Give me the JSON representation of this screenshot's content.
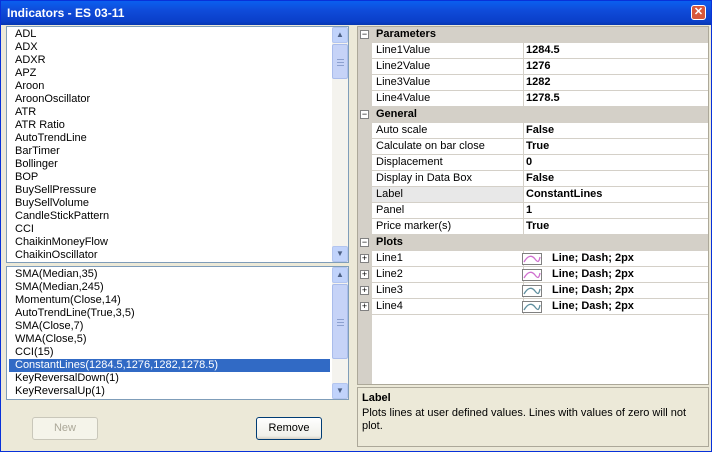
{
  "window": {
    "title": "Indicators - ES 03-11",
    "close_icon": "close-icon"
  },
  "indicator_list": {
    "items": [
      "ADL",
      "ADX",
      "ADXR",
      "APZ",
      "Aroon",
      "AroonOscillator",
      "ATR",
      "ATR Ratio",
      "AutoTrendLine",
      "BarTimer",
      "Bollinger",
      "BOP",
      "BuySellPressure",
      "BuySellVolume",
      "CandleStickPattern",
      "CCI",
      "ChaikinMoneyFlow",
      "ChaikinOscillator"
    ]
  },
  "applied_list": {
    "items": [
      "SMA(Median,35)",
      "SMA(Median,245)",
      "Momentum(Close,14)",
      "AutoTrendLine(True,3,5)",
      "SMA(Close,7)",
      "WMA(Close,5)",
      "CCI(15)",
      "ConstantLines(1284.5,1276,1282,1278.5)",
      "KeyReversalDown(1)",
      "KeyReversalUp(1)"
    ],
    "selected_index": 7
  },
  "buttons": {
    "new_label": "New",
    "remove_label": "Remove"
  },
  "properties": {
    "parameters": {
      "label": "Parameters",
      "rows": [
        {
          "name": "Line1Value",
          "value": "1284.5"
        },
        {
          "name": "Line2Value",
          "value": "1276"
        },
        {
          "name": "Line3Value",
          "value": "1282"
        },
        {
          "name": "Line4Value",
          "value": "1278.5"
        }
      ]
    },
    "general": {
      "label": "General",
      "rows": [
        {
          "name": "Auto scale",
          "value": "False"
        },
        {
          "name": "Calculate on bar close",
          "value": "True"
        },
        {
          "name": "Displacement",
          "value": "0"
        },
        {
          "name": "Display in Data Box",
          "value": "False"
        },
        {
          "name": "Label",
          "value": "ConstantLines"
        },
        {
          "name": "Panel",
          "value": "1"
        },
        {
          "name": "Price marker(s)",
          "value": "True"
        }
      ]
    },
    "plots": {
      "label": "Plots",
      "rows": [
        {
          "name": "Line1",
          "value": "Line; Dash; 2px",
          "color": "#D070D0"
        },
        {
          "name": "Line2",
          "value": "Line; Dash; 2px",
          "color": "#D070D0"
        },
        {
          "name": "Line3",
          "value": "Line; Dash; 2px",
          "color": "#5F8F9F"
        },
        {
          "name": "Line4",
          "value": "Line; Dash; 2px",
          "color": "#5F8F9F"
        }
      ]
    }
  },
  "description": {
    "title": "Label",
    "text": "Plots lines at user defined values. Lines with values of zero will not plot."
  }
}
